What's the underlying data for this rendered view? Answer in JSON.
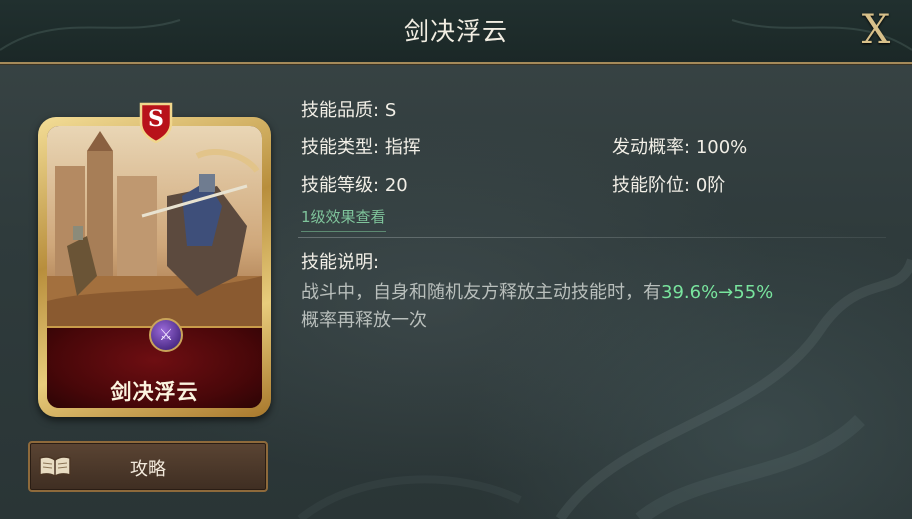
{
  "header": {
    "title": "剑决浮云",
    "close_label": "X"
  },
  "card": {
    "name": "剑决浮云",
    "grade": "S",
    "emblem_icon": "sword-emblem-icon"
  },
  "skill": {
    "quality_label": "技能品质:",
    "quality_value": "S",
    "type_label": "技能类型:",
    "type_value": "指挥",
    "trigger_label": "发动概率:",
    "trigger_value": "100%",
    "level_label": "技能等级:",
    "level_value": "20",
    "rank_label": "技能阶位:",
    "rank_value": "0阶",
    "effect_link": "1级效果查看",
    "desc_title": "技能说明:",
    "desc_prefix": "战斗中，自身和随机友方释放主动技能时，有",
    "desc_highlight": "39.6%→55%",
    "desc_line2": "概率再释放一次"
  },
  "guide": {
    "label": "攻略",
    "icon": "book-icon"
  },
  "colors": {
    "highlight": "#79e59e",
    "link": "#7fc49b",
    "gold": "#d8c08a",
    "card_panel": "#480709"
  }
}
